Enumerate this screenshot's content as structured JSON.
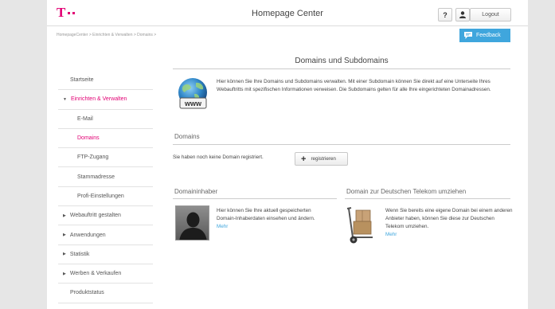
{
  "header": {
    "app_title": "Homepage Center",
    "help_label": "?",
    "logout_label": "Logout"
  },
  "brand": {
    "logo_letter": "T",
    "color": "#e20074"
  },
  "breadcrumb": "HomepageCenter > Einrichten & Verwalten > Domains >",
  "feedback_label": "Feedback",
  "accent_color": "#3fa6dd",
  "main": {
    "title": "Domains und Subdomains",
    "intro": "Hier können Sie Ihre Domains und Subdomains verwalten. Mit einer Subdomain können Sie direkt auf eine Unterseite Ihres Webauftritts mit spezifischen Informationen verweisen. Die Subdomains gelten für alle Ihre eingerichteten Domainadressen.",
    "globe_label": "www",
    "domains": {
      "heading": "Domains",
      "empty_text": "Sie haben noch keine Domain registriert.",
      "register_label": "registrieren"
    },
    "owner": {
      "heading": "Domaininhaber",
      "text": "Hier können Sie Ihre aktuell gespeicherten Domain-Inhaberdaten einsehen und ändern.",
      "more": "Mehr"
    },
    "transfer": {
      "heading": "Domain zur Deutschen Telekom umziehen",
      "text": "Wenn Sie bereits eine eigene Domain bei einem anderen Anbieter haben, können Sie diese zur Deutschen Telekom umziehen.",
      "more": "Mehr"
    }
  },
  "sidebar": {
    "items": [
      {
        "label": "Startseite"
      },
      {
        "label": "Einrichten & Verwalten",
        "expanded": true
      },
      {
        "label": "E-Mail"
      },
      {
        "label": "Domains",
        "current": true
      },
      {
        "label": "FTP-Zugang"
      },
      {
        "label": "Stammadresse"
      },
      {
        "label": "Profi-Einstellungen"
      },
      {
        "label": "Webauftritt gestalten"
      },
      {
        "label": "Anwendungen"
      },
      {
        "label": "Statistik"
      },
      {
        "label": "Werben & Verkaufen"
      },
      {
        "label": "Produktstatus"
      }
    ]
  }
}
